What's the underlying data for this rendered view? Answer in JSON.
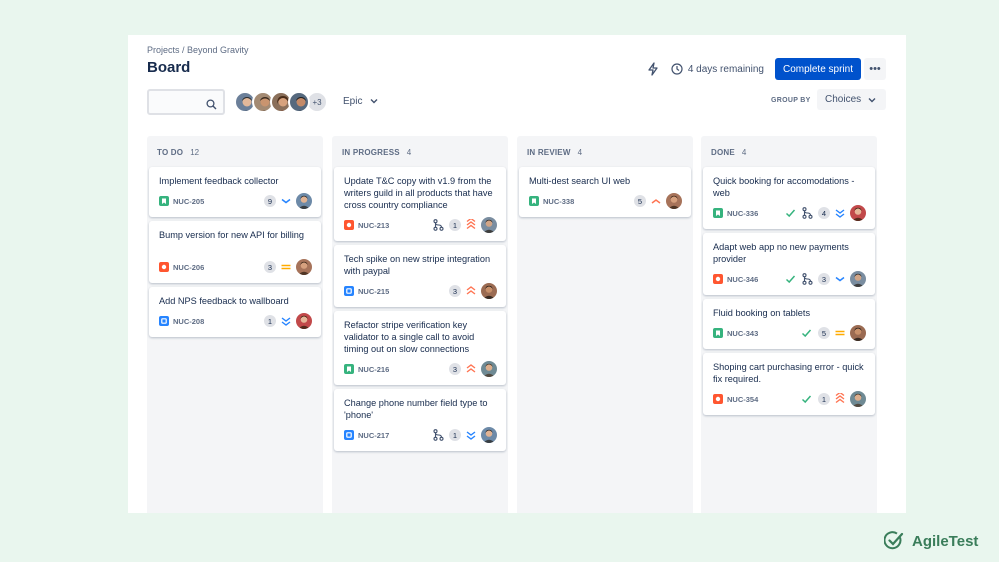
{
  "header": {
    "breadcrumb": "Projects / Beyond Gravity",
    "title": "Board",
    "remaining": "4 days remaining",
    "complete_sprint": "Complete sprint",
    "more": "•••"
  },
  "toolbar": {
    "search_placeholder": "",
    "avatars_more": "+3",
    "epic_label": "Epic",
    "groupby_label": "GROUP BY",
    "groupby_value": "Choices"
  },
  "colors": {
    "primary": "#0052cc",
    "story": "#36b37e",
    "bug": "#ff5630",
    "task": "#2684ff",
    "priority_high": "#ff7452",
    "priority_medium": "#ffab00",
    "priority_low": "#2684ff"
  },
  "columns": [
    {
      "title": "TO DO",
      "count": "12",
      "cards": [
        {
          "title": "Implement feedback collector",
          "key": "NUC-205",
          "type": "story",
          "points": "9",
          "priority": "low",
          "done": false,
          "branch": false
        },
        {
          "title": "Bump version for new API for billing",
          "key": "NUC-206",
          "type": "bug",
          "points": "3",
          "priority": "medium",
          "done": false,
          "branch": false
        },
        {
          "title": "Add NPS feedback to wallboard",
          "key": "NUC-208",
          "type": "task",
          "points": "1",
          "priority": "lowest",
          "done": false,
          "branch": false
        }
      ]
    },
    {
      "title": "IN PROGRESS",
      "count": "4",
      "cards": [
        {
          "title": "Update T&C copy with v1.9 from the writers guild in all products that have cross country compliance",
          "key": "NUC-213",
          "type": "bug",
          "points": "1",
          "priority": "highest",
          "done": false,
          "branch": true
        },
        {
          "title": "Tech spike on new stripe integration with paypal",
          "key": "NUC-215",
          "type": "task",
          "points": "3",
          "priority": "high",
          "done": false,
          "branch": false
        },
        {
          "title": "Refactor stripe verification key validator to a single call to avoid timing out on slow connections",
          "key": "NUC-216",
          "type": "story",
          "points": "3",
          "priority": "high",
          "done": false,
          "branch": false
        },
        {
          "title": "Change phone number field type to 'phone'",
          "key": "NUC-217",
          "type": "task",
          "points": "1",
          "priority": "lowest",
          "done": false,
          "branch": true
        }
      ]
    },
    {
      "title": "IN REVIEW",
      "count": "4",
      "cards": [
        {
          "title": "Multi-dest search UI web",
          "key": "NUC-338",
          "type": "story",
          "points": "5",
          "priority": "up",
          "done": false,
          "branch": false
        }
      ]
    },
    {
      "title": "DONE",
      "count": "4",
      "cards": [
        {
          "title": "Quick booking for accomodations - web",
          "key": "NUC-336",
          "type": "story",
          "points": "4",
          "priority": "lowest",
          "done": true,
          "branch": true
        },
        {
          "title": "Adapt web app no new payments provider",
          "key": "NUC-346",
          "type": "bug",
          "points": "3",
          "priority": "low",
          "done": true,
          "branch": true
        },
        {
          "title": "Fluid booking on tablets",
          "key": "NUC-343",
          "type": "story",
          "points": "5",
          "priority": "medium",
          "done": true,
          "branch": false
        },
        {
          "title": "Shoping cart purchasing error - quick fix required.",
          "key": "NUC-354",
          "type": "bug",
          "points": "1",
          "priority": "highest",
          "done": true,
          "branch": false
        }
      ]
    }
  ],
  "brand": {
    "name": "AgileTest"
  }
}
